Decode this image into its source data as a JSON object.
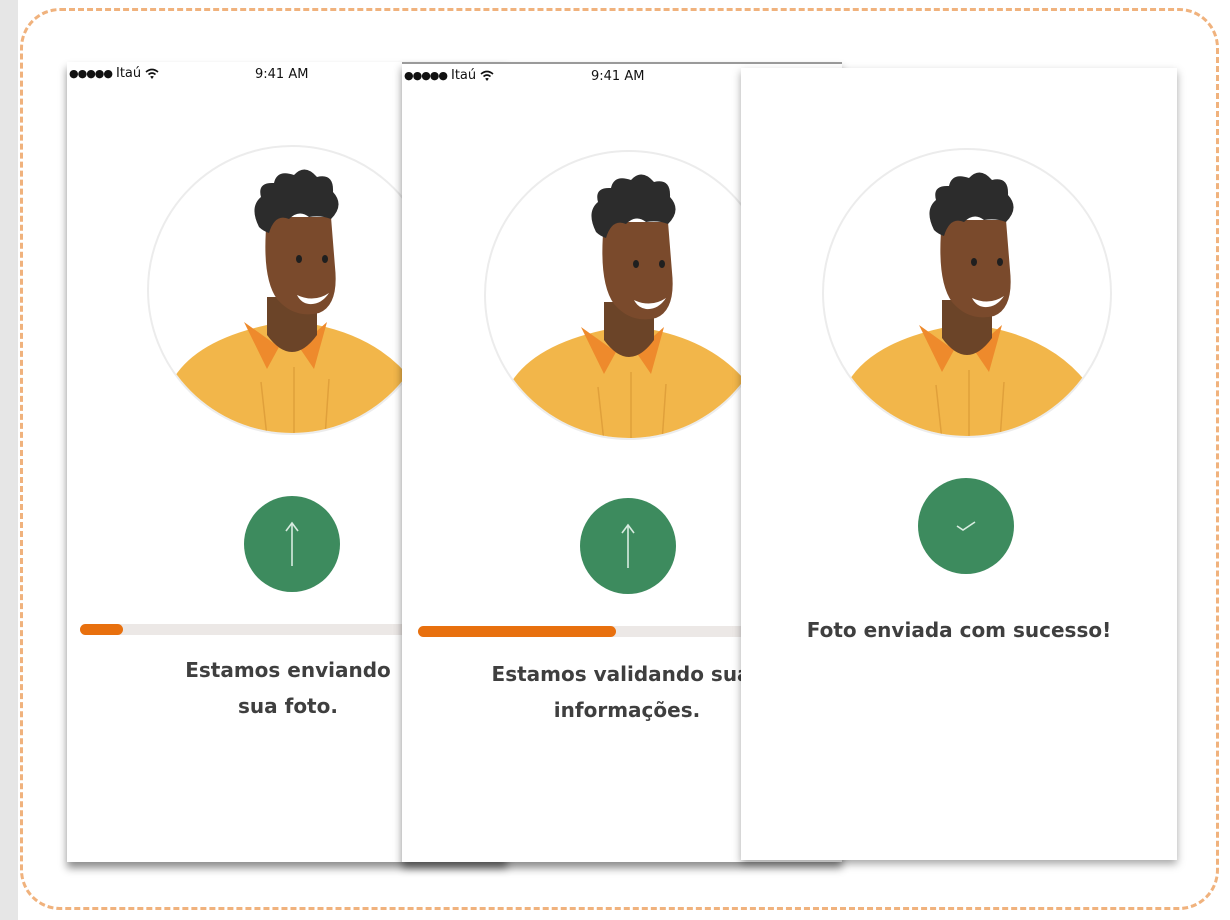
{
  "colors": {
    "accent_orange": "#e8700e",
    "action_green": "#3d8b5e",
    "progress_track": "#ece8e6",
    "frame_dashed": "#f0b27d",
    "text_dark": "#3f3f3f"
  },
  "screens": [
    {
      "status_bar": {
        "signal_dots": "●●●●●",
        "carrier": "Itaú",
        "time": "9:41 AM"
      },
      "action_icon": "arrow-up-icon",
      "progress": {
        "fraction": 0.1
      },
      "message_line1": "Estamos enviando",
      "message_line2": "sua foto."
    },
    {
      "status_bar": {
        "signal_dots": "●●●●●",
        "carrier": "Itaú",
        "time": "9:41 AM"
      },
      "action_icon": "arrow-up-icon",
      "progress": {
        "fraction": 0.6
      },
      "message_line1": "Estamos validando suas",
      "message_line2": "informações."
    },
    {
      "action_icon": "checkmark-icon",
      "message_line1": "Foto enviada com sucesso!"
    }
  ]
}
